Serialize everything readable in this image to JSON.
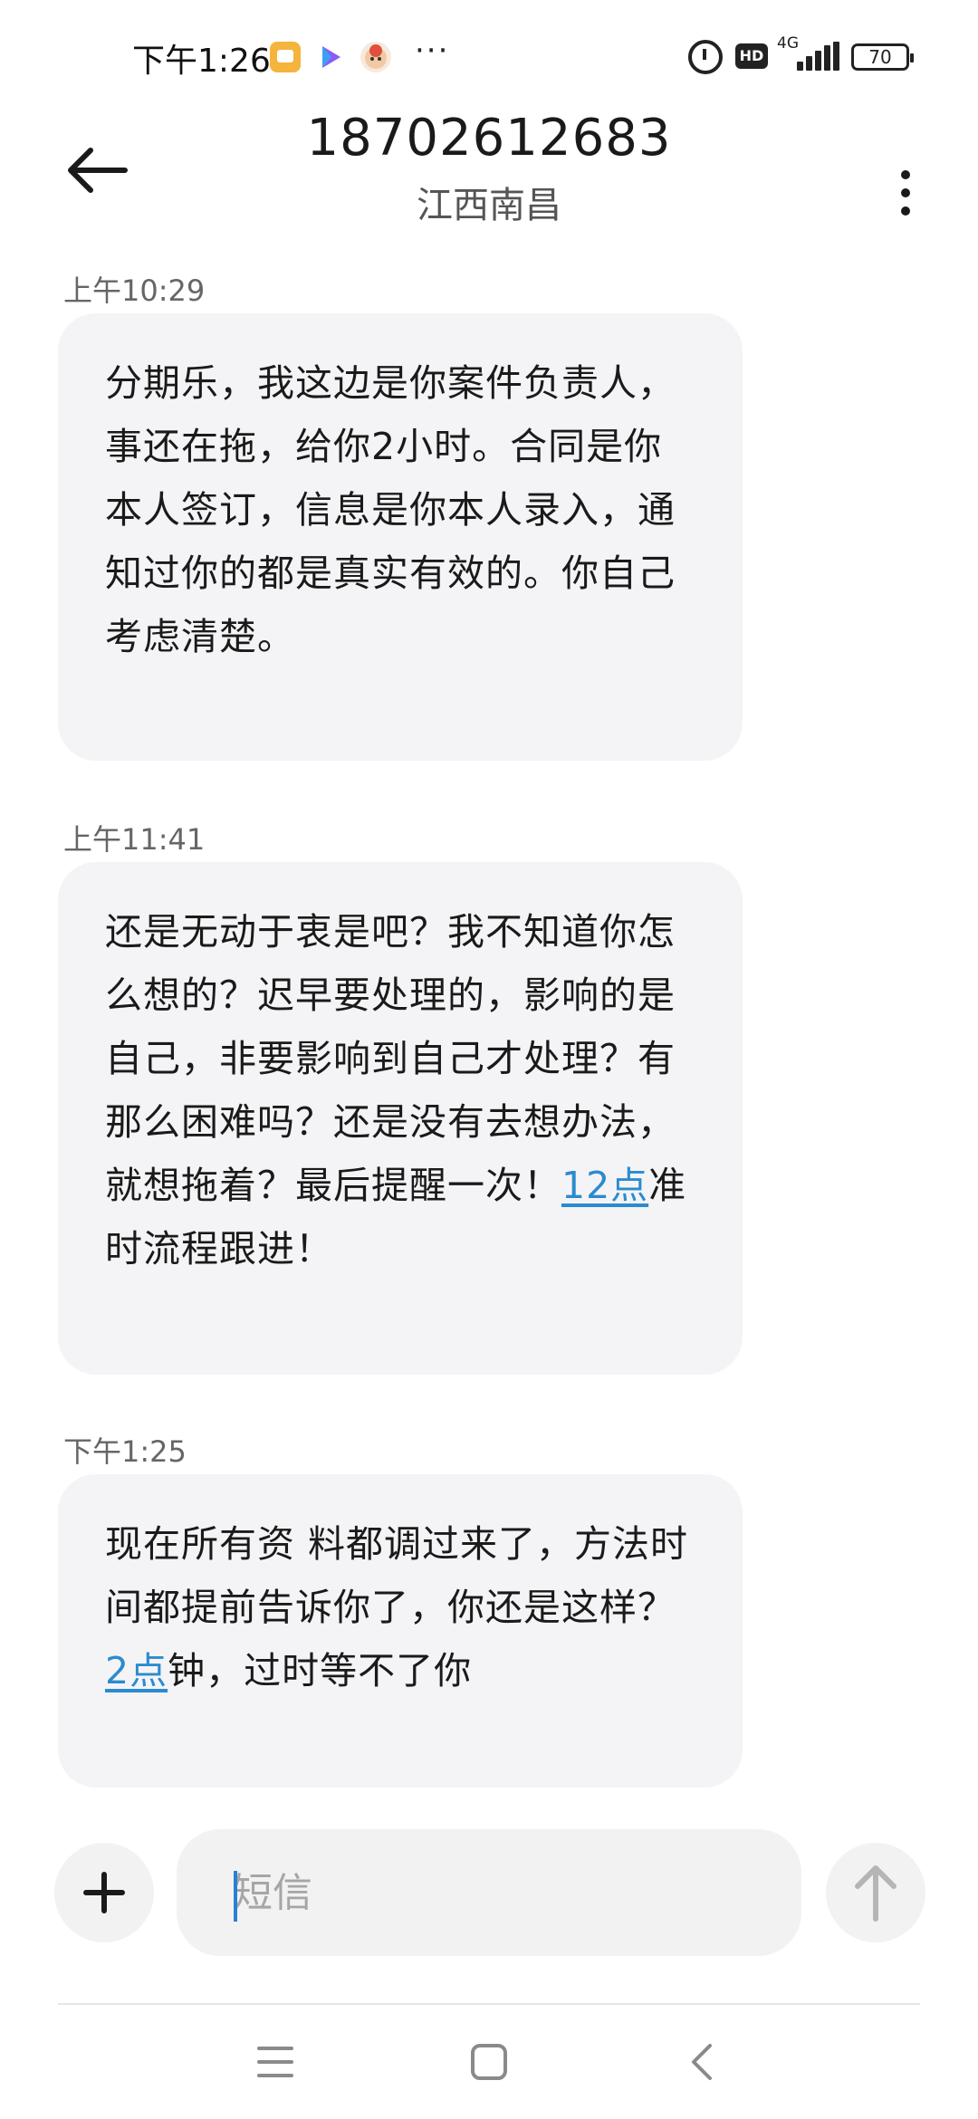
{
  "status_bar": {
    "time": "下午1:26",
    "dots": "···",
    "hd": "HD",
    "network": "4G",
    "battery": "70"
  },
  "header": {
    "title": "18702612683",
    "subtitle": "江西南昌"
  },
  "messages": [
    {
      "time": "上午10:29",
      "text": "分期乐，我这边是你案件负责人，事还在拖，给你2小时。合同是你本人签订，信息是你本人录入，通知过你的都是真实有效的。你自己考虑清楚。"
    },
    {
      "time": "上午11:41",
      "text_before": "还是无动于衷是吧？我不知道你怎么想的？迟早要处理的，影响的是自己，非要影响到自己才处理？有那么困难吗？还是没有去想办法，就想拖着？最后提醒一次！",
      "link": "12点",
      "text_after": "准时流程跟进！"
    },
    {
      "time": "下午1:25",
      "text_before": "现在所有资 料都调过来了，方法时间都提前告诉你了，你还是这样？",
      "link": "2点",
      "text_after": "钟，过时等不了你"
    }
  ],
  "composer": {
    "placeholder": "短信"
  },
  "icons": {
    "back": "arrow-left-icon",
    "more": "more-vertical-icon",
    "add": "plus-icon",
    "send": "arrow-up-icon",
    "nav_menu": "menu-icon",
    "nav_home": "square-icon",
    "nav_back": "chevron-left-icon"
  },
  "colors": {
    "bubble": "#f4f4f6",
    "link": "#2b8bcf",
    "caret": "#2b7fd4"
  }
}
